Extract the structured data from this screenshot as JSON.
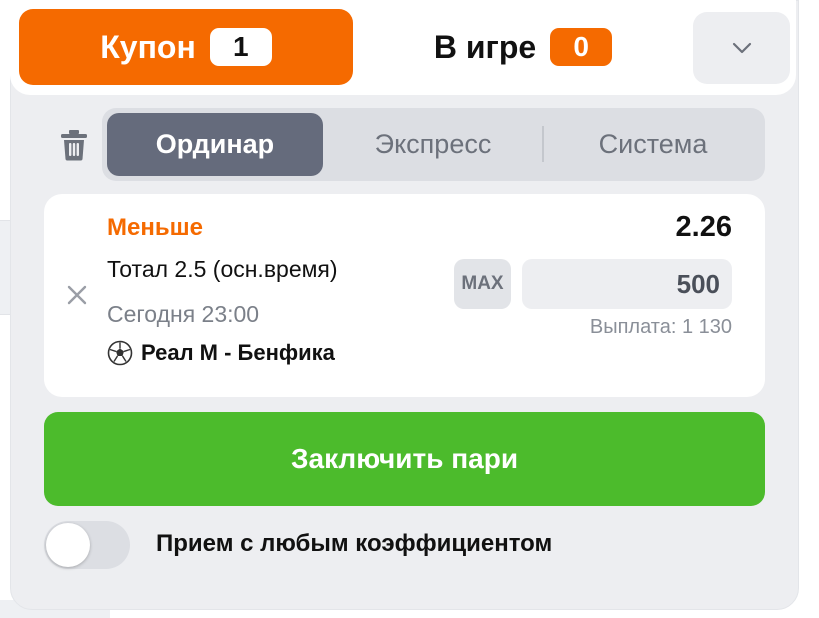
{
  "tabs": {
    "coupon": {
      "label": "Купон",
      "count": "1"
    },
    "live": {
      "label": "В игре",
      "count": "0"
    }
  },
  "icons": {
    "collapse": "chevron-down-icon",
    "trash": "trash-icon",
    "remove": "close-icon",
    "sport": "soccer-ball-icon"
  },
  "bet_types": [
    {
      "label": "Ординар",
      "active": true
    },
    {
      "label": "Экспресс",
      "active": false
    },
    {
      "label": "Система",
      "active": false
    }
  ],
  "bet": {
    "outcome": "Меньше",
    "odds": "2.26",
    "market": "Тотал 2.5 (осн.время)",
    "datetime": "Сегодня 23:00",
    "match": "Реал М - Бенфика",
    "max_label": "MAX",
    "stake": "500",
    "payout": "Выплата: 1 130"
  },
  "submit_label": "Заключить пари",
  "accept_any_odds": {
    "label": "Прием с любым коэффициентом",
    "enabled": false
  },
  "colors": {
    "accent": "#f56a00",
    "success": "#4cbb2c",
    "active_segment": "#656b7c",
    "panel_bg": "#edeef1"
  }
}
